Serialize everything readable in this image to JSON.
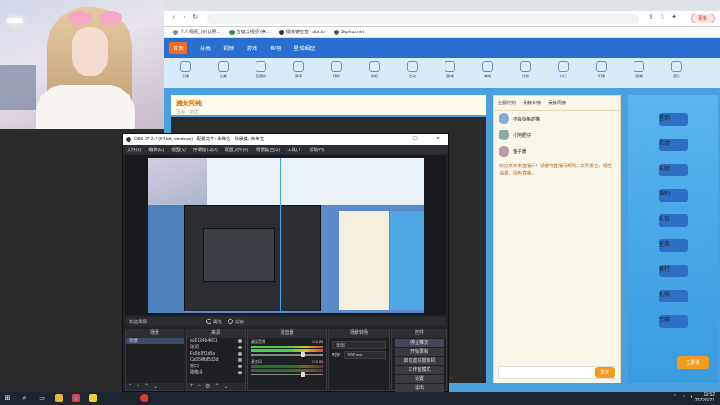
{
  "browser": {
    "tabs_icons": [
      "back-arrow",
      "forward-arrow",
      "reload"
    ],
    "update_label": "更新",
    "bookmarks": [
      {
        "label": "个人视频_5对比照..."
      },
      {
        "label": "吉莲云视频 (美..."
      },
      {
        "label": "摄像镜检查 - abit.io"
      },
      {
        "label": "Sephus.net"
      }
    ]
  },
  "site": {
    "nav": [
      "首页",
      "分类",
      "视频",
      "游戏",
      "鱼吧",
      "星域崛起"
    ],
    "categories": [
      "主播",
      "分类",
      "直播间",
      "赛事",
      "榜单",
      "鱼吧",
      "活动",
      "游戏",
      "商城",
      "任务",
      "排行",
      "开播",
      "视频",
      "音乐"
    ],
    "room_title": "渡女阿纯",
    "room_sub": "互动 · 关注",
    "chat_tabs": [
      "全服时刻",
      "贡献日榜",
      "贡献周榜"
    ],
    "chat_users": [
      {
        "name": "不会捉鱼的猫"
      },
      {
        "name": "小阿肥仔"
      },
      {
        "name": "鱼子酱"
      }
    ],
    "chat_message": "欢迎来到本直播间！请遵守直播间规则，文明发言，理性消费，绿色直播。",
    "send_label": "发送",
    "ad_label": "立即领",
    "ad_badges": [
      "签到",
      "活动",
      "奖励",
      "福利",
      "礼包",
      "任务",
      "排行",
      "礼物",
      "宝箱"
    ]
  },
  "obs": {
    "title": "OBS 27.2.4 (64-bit, windows) - 配置文件: 未命名 - 场景集: 未命名",
    "menu": [
      "文件(F)",
      "编辑(E)",
      "视图(V)",
      "停靠窗口(D)",
      "配置文件(P)",
      "场景集合(S)",
      "工具(T)",
      "帮助(H)"
    ],
    "srcbar_label": "未选择源",
    "srcbar_buttons": [
      "属性",
      "滤镜"
    ],
    "scenes": {
      "header": "场景",
      "items": [
        "场景"
      ]
    },
    "sources": {
      "header": "来源",
      "items": [
        "a56184b4651",
        "歌词",
        "Fa5b1ff1d8a",
        "Ca550fbf5d3d",
        "窗口",
        "摄像头"
      ]
    },
    "mixer": {
      "header": "混音器",
      "channels": [
        {
          "name": "桌面音频",
          "level": "0.0 dB"
        },
        {
          "name": "麦克风",
          "level": "0.0 dB"
        }
      ]
    },
    "transitions": {
      "header": "场景转场",
      "mode": "淡出",
      "duration_label": "时长",
      "duration": "300 ms"
    },
    "controls": {
      "header": "控件",
      "buttons": [
        "停止推流",
        "开始录制",
        "启动虚拟摄像机",
        "工作室模式",
        "设置",
        "退出"
      ]
    }
  },
  "taskbar": {
    "clock_time": "19:52",
    "clock_date": "2022/6/21"
  }
}
